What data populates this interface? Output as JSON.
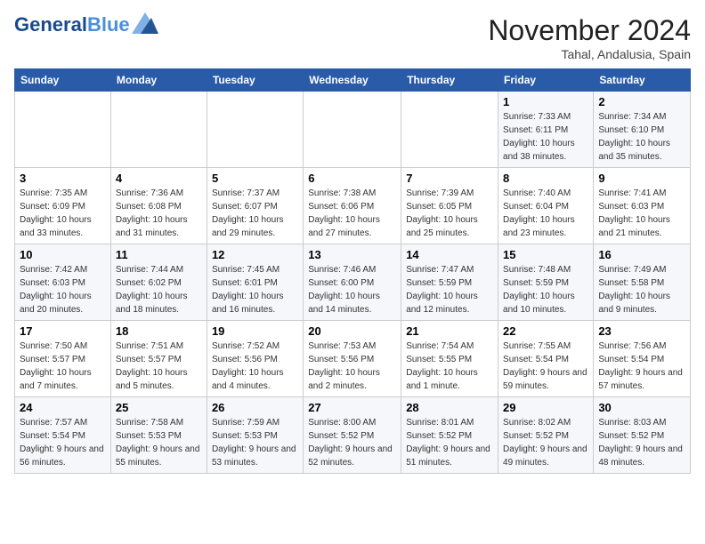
{
  "logo": {
    "line1": "General",
    "line2": "Blue"
  },
  "title": "November 2024",
  "location": "Tahal, Andalusia, Spain",
  "weekdays": [
    "Sunday",
    "Monday",
    "Tuesday",
    "Wednesday",
    "Thursday",
    "Friday",
    "Saturday"
  ],
  "weeks": [
    [
      {
        "day": "",
        "sunrise": "",
        "sunset": "",
        "daylight": ""
      },
      {
        "day": "",
        "sunrise": "",
        "sunset": "",
        "daylight": ""
      },
      {
        "day": "",
        "sunrise": "",
        "sunset": "",
        "daylight": ""
      },
      {
        "day": "",
        "sunrise": "",
        "sunset": "",
        "daylight": ""
      },
      {
        "day": "",
        "sunrise": "",
        "sunset": "",
        "daylight": ""
      },
      {
        "day": "1",
        "sunrise": "Sunrise: 7:33 AM",
        "sunset": "Sunset: 6:11 PM",
        "daylight": "Daylight: 10 hours and 38 minutes."
      },
      {
        "day": "2",
        "sunrise": "Sunrise: 7:34 AM",
        "sunset": "Sunset: 6:10 PM",
        "daylight": "Daylight: 10 hours and 35 minutes."
      }
    ],
    [
      {
        "day": "3",
        "sunrise": "Sunrise: 7:35 AM",
        "sunset": "Sunset: 6:09 PM",
        "daylight": "Daylight: 10 hours and 33 minutes."
      },
      {
        "day": "4",
        "sunrise": "Sunrise: 7:36 AM",
        "sunset": "Sunset: 6:08 PM",
        "daylight": "Daylight: 10 hours and 31 minutes."
      },
      {
        "day": "5",
        "sunrise": "Sunrise: 7:37 AM",
        "sunset": "Sunset: 6:07 PM",
        "daylight": "Daylight: 10 hours and 29 minutes."
      },
      {
        "day": "6",
        "sunrise": "Sunrise: 7:38 AM",
        "sunset": "Sunset: 6:06 PM",
        "daylight": "Daylight: 10 hours and 27 minutes."
      },
      {
        "day": "7",
        "sunrise": "Sunrise: 7:39 AM",
        "sunset": "Sunset: 6:05 PM",
        "daylight": "Daylight: 10 hours and 25 minutes."
      },
      {
        "day": "8",
        "sunrise": "Sunrise: 7:40 AM",
        "sunset": "Sunset: 6:04 PM",
        "daylight": "Daylight: 10 hours and 23 minutes."
      },
      {
        "day": "9",
        "sunrise": "Sunrise: 7:41 AM",
        "sunset": "Sunset: 6:03 PM",
        "daylight": "Daylight: 10 hours and 21 minutes."
      }
    ],
    [
      {
        "day": "10",
        "sunrise": "Sunrise: 7:42 AM",
        "sunset": "Sunset: 6:03 PM",
        "daylight": "Daylight: 10 hours and 20 minutes."
      },
      {
        "day": "11",
        "sunrise": "Sunrise: 7:44 AM",
        "sunset": "Sunset: 6:02 PM",
        "daylight": "Daylight: 10 hours and 18 minutes."
      },
      {
        "day": "12",
        "sunrise": "Sunrise: 7:45 AM",
        "sunset": "Sunset: 6:01 PM",
        "daylight": "Daylight: 10 hours and 16 minutes."
      },
      {
        "day": "13",
        "sunrise": "Sunrise: 7:46 AM",
        "sunset": "Sunset: 6:00 PM",
        "daylight": "Daylight: 10 hours and 14 minutes."
      },
      {
        "day": "14",
        "sunrise": "Sunrise: 7:47 AM",
        "sunset": "Sunset: 5:59 PM",
        "daylight": "Daylight: 10 hours and 12 minutes."
      },
      {
        "day": "15",
        "sunrise": "Sunrise: 7:48 AM",
        "sunset": "Sunset: 5:59 PM",
        "daylight": "Daylight: 10 hours and 10 minutes."
      },
      {
        "day": "16",
        "sunrise": "Sunrise: 7:49 AM",
        "sunset": "Sunset: 5:58 PM",
        "daylight": "Daylight: 10 hours and 9 minutes."
      }
    ],
    [
      {
        "day": "17",
        "sunrise": "Sunrise: 7:50 AM",
        "sunset": "Sunset: 5:57 PM",
        "daylight": "Daylight: 10 hours and 7 minutes."
      },
      {
        "day": "18",
        "sunrise": "Sunrise: 7:51 AM",
        "sunset": "Sunset: 5:57 PM",
        "daylight": "Daylight: 10 hours and 5 minutes."
      },
      {
        "day": "19",
        "sunrise": "Sunrise: 7:52 AM",
        "sunset": "Sunset: 5:56 PM",
        "daylight": "Daylight: 10 hours and 4 minutes."
      },
      {
        "day": "20",
        "sunrise": "Sunrise: 7:53 AM",
        "sunset": "Sunset: 5:56 PM",
        "daylight": "Daylight: 10 hours and 2 minutes."
      },
      {
        "day": "21",
        "sunrise": "Sunrise: 7:54 AM",
        "sunset": "Sunset: 5:55 PM",
        "daylight": "Daylight: 10 hours and 1 minute."
      },
      {
        "day": "22",
        "sunrise": "Sunrise: 7:55 AM",
        "sunset": "Sunset: 5:54 PM",
        "daylight": "Daylight: 9 hours and 59 minutes."
      },
      {
        "day": "23",
        "sunrise": "Sunrise: 7:56 AM",
        "sunset": "Sunset: 5:54 PM",
        "daylight": "Daylight: 9 hours and 57 minutes."
      }
    ],
    [
      {
        "day": "24",
        "sunrise": "Sunrise: 7:57 AM",
        "sunset": "Sunset: 5:54 PM",
        "daylight": "Daylight: 9 hours and 56 minutes."
      },
      {
        "day": "25",
        "sunrise": "Sunrise: 7:58 AM",
        "sunset": "Sunset: 5:53 PM",
        "daylight": "Daylight: 9 hours and 55 minutes."
      },
      {
        "day": "26",
        "sunrise": "Sunrise: 7:59 AM",
        "sunset": "Sunset: 5:53 PM",
        "daylight": "Daylight: 9 hours and 53 minutes."
      },
      {
        "day": "27",
        "sunrise": "Sunrise: 8:00 AM",
        "sunset": "Sunset: 5:52 PM",
        "daylight": "Daylight: 9 hours and 52 minutes."
      },
      {
        "day": "28",
        "sunrise": "Sunrise: 8:01 AM",
        "sunset": "Sunset: 5:52 PM",
        "daylight": "Daylight: 9 hours and 51 minutes."
      },
      {
        "day": "29",
        "sunrise": "Sunrise: 8:02 AM",
        "sunset": "Sunset: 5:52 PM",
        "daylight": "Daylight: 9 hours and 49 minutes."
      },
      {
        "day": "30",
        "sunrise": "Sunrise: 8:03 AM",
        "sunset": "Sunset: 5:52 PM",
        "daylight": "Daylight: 9 hours and 48 minutes."
      }
    ]
  ]
}
